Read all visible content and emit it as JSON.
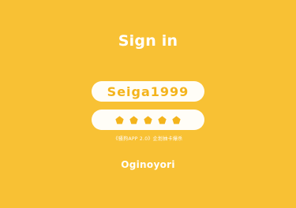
{
  "page": {
    "title": "Sign in",
    "background_color": "#F8C134"
  },
  "login": {
    "username_value": "Seiga1999",
    "password_mask_count": 5,
    "password_mask_icon": "pentagon-star-icon",
    "field_background": "#FFFDF7",
    "accent_color": "#F4B41C"
  },
  "notice": {
    "text": "《骚狗APP 2.0》企划抽卡爆杀"
  },
  "brand": {
    "name": "Oginoyori"
  }
}
